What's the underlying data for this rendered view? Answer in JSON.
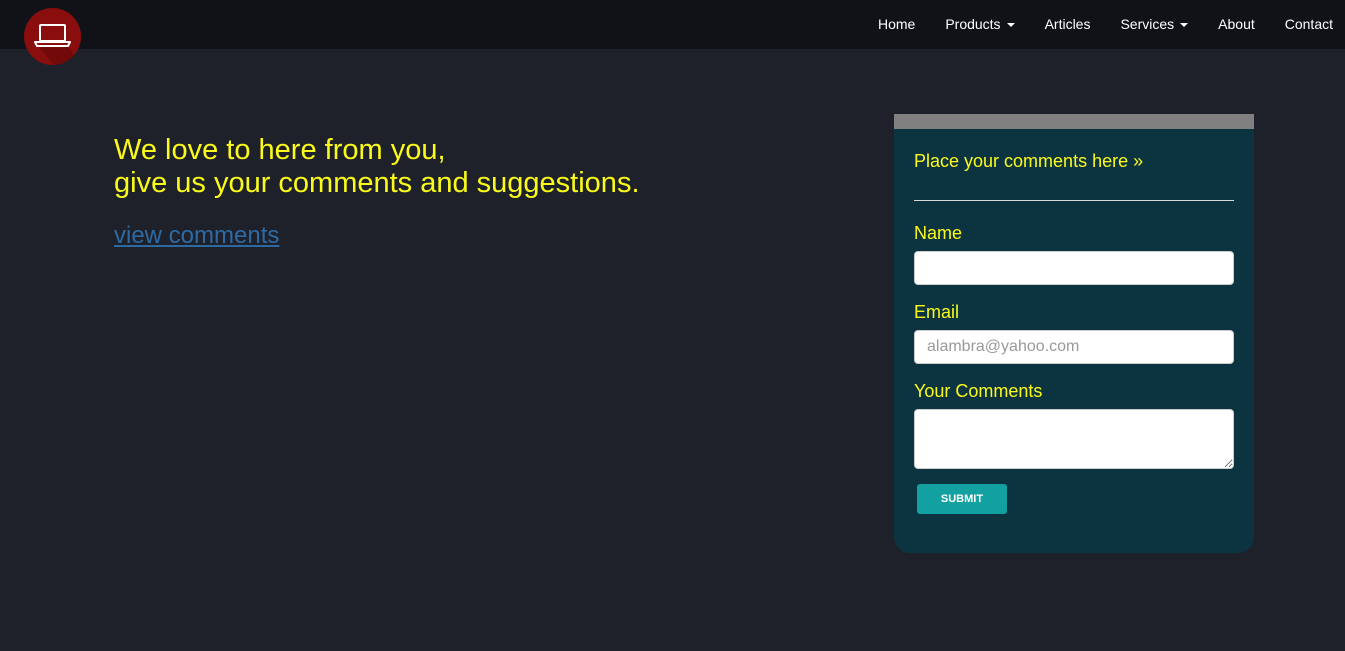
{
  "nav": {
    "logo_icon": "laptop-icon",
    "items": [
      {
        "label": "Home",
        "dropdown": false
      },
      {
        "label": "Products",
        "dropdown": true
      },
      {
        "label": "Articles",
        "dropdown": false
      },
      {
        "label": "Services",
        "dropdown": true
      },
      {
        "label": "About",
        "dropdown": false
      },
      {
        "label": "Contact",
        "dropdown": false
      }
    ]
  },
  "intro": {
    "line1": "We love to here from you,",
    "line2": "give us your comments and suggestions.",
    "link": "view comments"
  },
  "form": {
    "title": "Place your comments here »",
    "name_label": "Name",
    "name_value": "",
    "email_label": "Email",
    "email_placeholder": "alambra@yahoo.com",
    "comments_label": "Your Comments",
    "comments_value": "",
    "submit_label": "SUBMIT"
  },
  "colors": {
    "background": "#1e212a",
    "navbar": "#101217",
    "accent_yellow": "#fbfb1a",
    "panel": "#0c3440",
    "submit": "#13a0a0",
    "logo": "#8b0e0e",
    "link": "#2d6aa3"
  }
}
